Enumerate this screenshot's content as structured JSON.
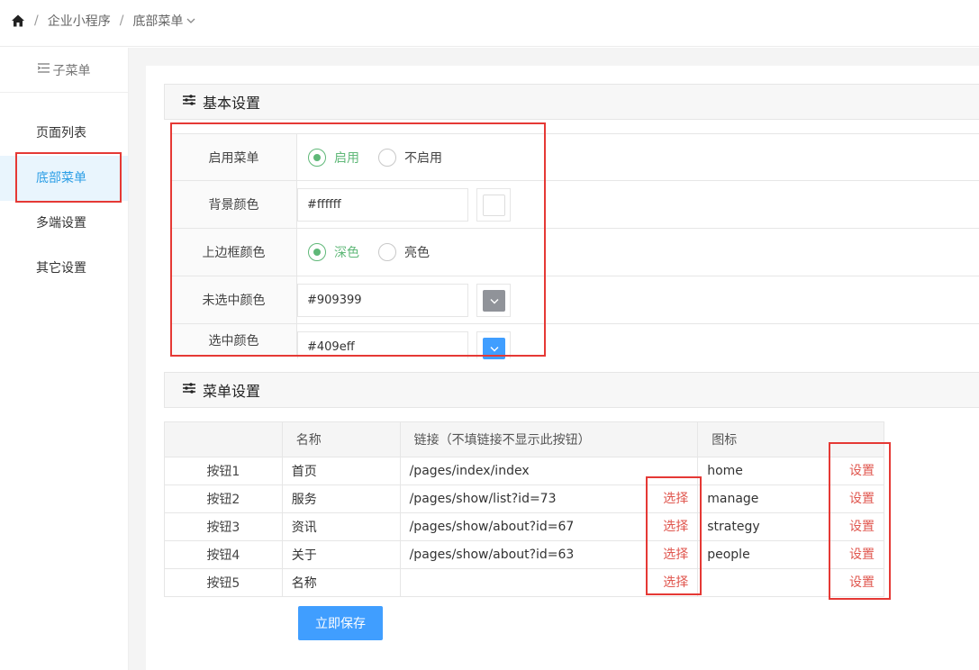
{
  "breadcrumb": {
    "home_icon": "home-icon",
    "items": [
      "企业小程序",
      "底部菜单"
    ],
    "separator": "/"
  },
  "sidebar": {
    "title": "子菜单",
    "title_icon": "menu-list-icon",
    "items": [
      {
        "label": "页面列表",
        "active": false
      },
      {
        "label": "底部菜单",
        "active": true
      },
      {
        "label": "多端设置",
        "active": false
      },
      {
        "label": "其它设置",
        "active": false
      }
    ]
  },
  "basic": {
    "title": "基本设置",
    "title_icon": "sliders-icon",
    "enable": {
      "label": "启用菜单",
      "options": [
        "启用",
        "不启用"
      ],
      "selected": "启用"
    },
    "bg_color": {
      "label": "背景颜色",
      "value": "#ffffff",
      "swatch": "#ffffff"
    },
    "border_color": {
      "label": "上边框颜色",
      "options": [
        "深色",
        "亮色"
      ],
      "selected": "深色"
    },
    "unselected_color": {
      "label": "未选中颜色",
      "value": "#909399",
      "swatch": "#909399"
    },
    "selected_color": {
      "label": "选中颜色",
      "value": "#409eff",
      "swatch": "#409eff"
    }
  },
  "menu": {
    "title": "菜单设置",
    "title_icon": "sliders-icon",
    "columns": [
      "",
      "名称",
      "链接（不填链接不显示此按钮）",
      "图标"
    ],
    "pick_label": "选择",
    "set_label": "设置",
    "rows": [
      {
        "button": "按钮1",
        "name": "首页",
        "link": "/pages/index/index",
        "icon": "home",
        "pick": false
      },
      {
        "button": "按钮2",
        "name": "服务",
        "link": "/pages/show/list?id=73",
        "icon": "manage",
        "pick": true
      },
      {
        "button": "按钮3",
        "name": "资讯",
        "link": "/pages/show/about?id=67",
        "icon": "strategy",
        "pick": true
      },
      {
        "button": "按钮4",
        "name": "关于",
        "link": "/pages/show/about?id=63",
        "icon": "people",
        "pick": true
      },
      {
        "button": "按钮5",
        "name": "名称",
        "link": "",
        "icon": "",
        "pick": true
      }
    ]
  },
  "save_label": "立即保存",
  "colors": {
    "accent": "#409eff",
    "radio_on": "#5fb878",
    "annotation_red": "#e53935",
    "link_red": "#e0574f"
  }
}
